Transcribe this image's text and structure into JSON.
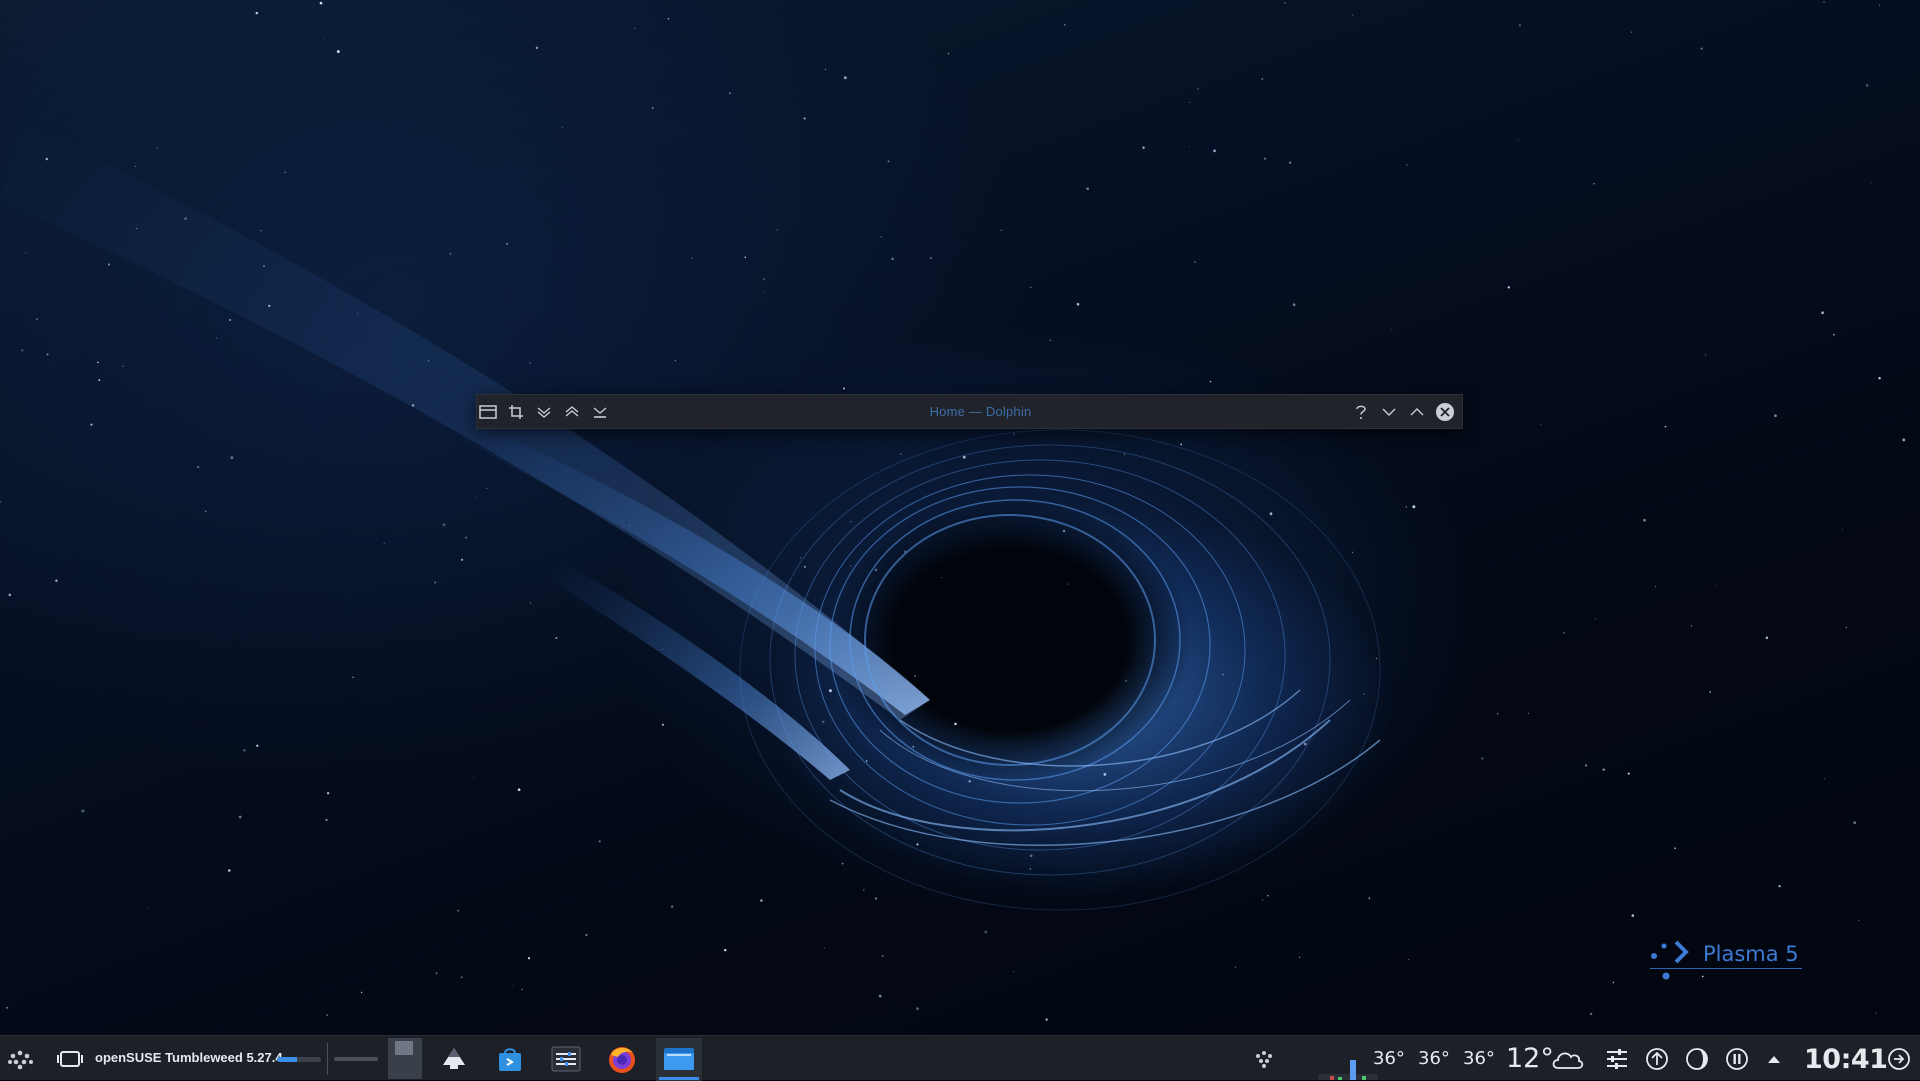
{
  "window": {
    "title": "Home — Dolphin",
    "buttons_left": [
      "window-menu-icon",
      "crop-icon",
      "shade-down-icon",
      "keep-above-icon",
      "keep-below-icon"
    ],
    "buttons_right": [
      "help-icon",
      "minimize-icon",
      "maximize-icon",
      "close-icon"
    ]
  },
  "desktop": {
    "logo_text": "Plasma 5"
  },
  "taskbar": {
    "active_task": {
      "label": "openSUSE Tumbleweed 5.27.4",
      "progress": 0.45
    },
    "launchers": [
      {
        "name": "vlc-cone-launcher",
        "icon": "inkscape-icon"
      },
      {
        "name": "discover-launcher",
        "icon": "store-icon"
      },
      {
        "name": "settings-launcher",
        "icon": "system-settings-icon"
      },
      {
        "name": "firefox-launcher",
        "icon": "firefox-icon"
      },
      {
        "name": "dolphin-launcher",
        "icon": "folder-icon"
      }
    ],
    "tray": {
      "temps": [
        "36°",
        "36°",
        "36°"
      ],
      "weather_temp": "12°",
      "weather_icon": "cloud-icon",
      "clock": "10:41"
    }
  },
  "colors": {
    "accent": "#3d8ee8",
    "panel": "#1d2127",
    "titlebar": "#202329",
    "title_text": "#3d6ea8"
  }
}
